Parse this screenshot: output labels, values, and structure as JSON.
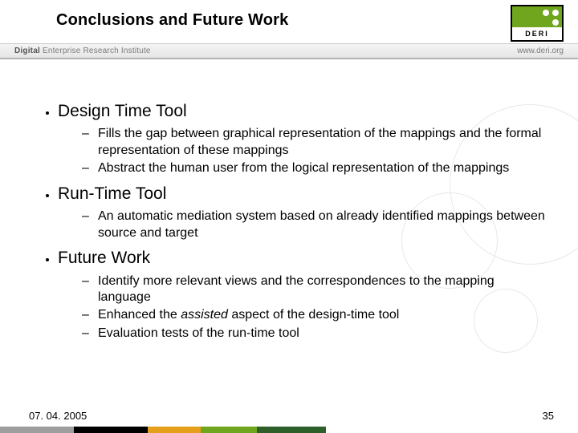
{
  "header": {
    "title": "Conclusions and Future Work",
    "logo_text": "DERI"
  },
  "subbar": {
    "left_strong": "Digital",
    "left_rest": " Enterprise Research Institute",
    "right": "www.deri.org"
  },
  "content": {
    "sections": [
      {
        "title": "Design Time Tool",
        "items": [
          "Fills the gap between graphical representation of the mappings and the formal representation of these mappings",
          "Abstract the human user from the logical representation of the mappings"
        ]
      },
      {
        "title": "Run-Time Tool",
        "items": [
          "An automatic mediation system based on already identified mappings between source and target"
        ]
      },
      {
        "title": "Future Work",
        "items": [
          "Identify more relevant views and the correspondences to the mapping language",
          {
            "pre": "Enhanced the ",
            "em": "assisted",
            "post": " aspect of the design-time tool"
          },
          "Evaluation tests of the run-time tool"
        ]
      }
    ]
  },
  "footer": {
    "date": "07. 04. 2005",
    "page": "35"
  }
}
